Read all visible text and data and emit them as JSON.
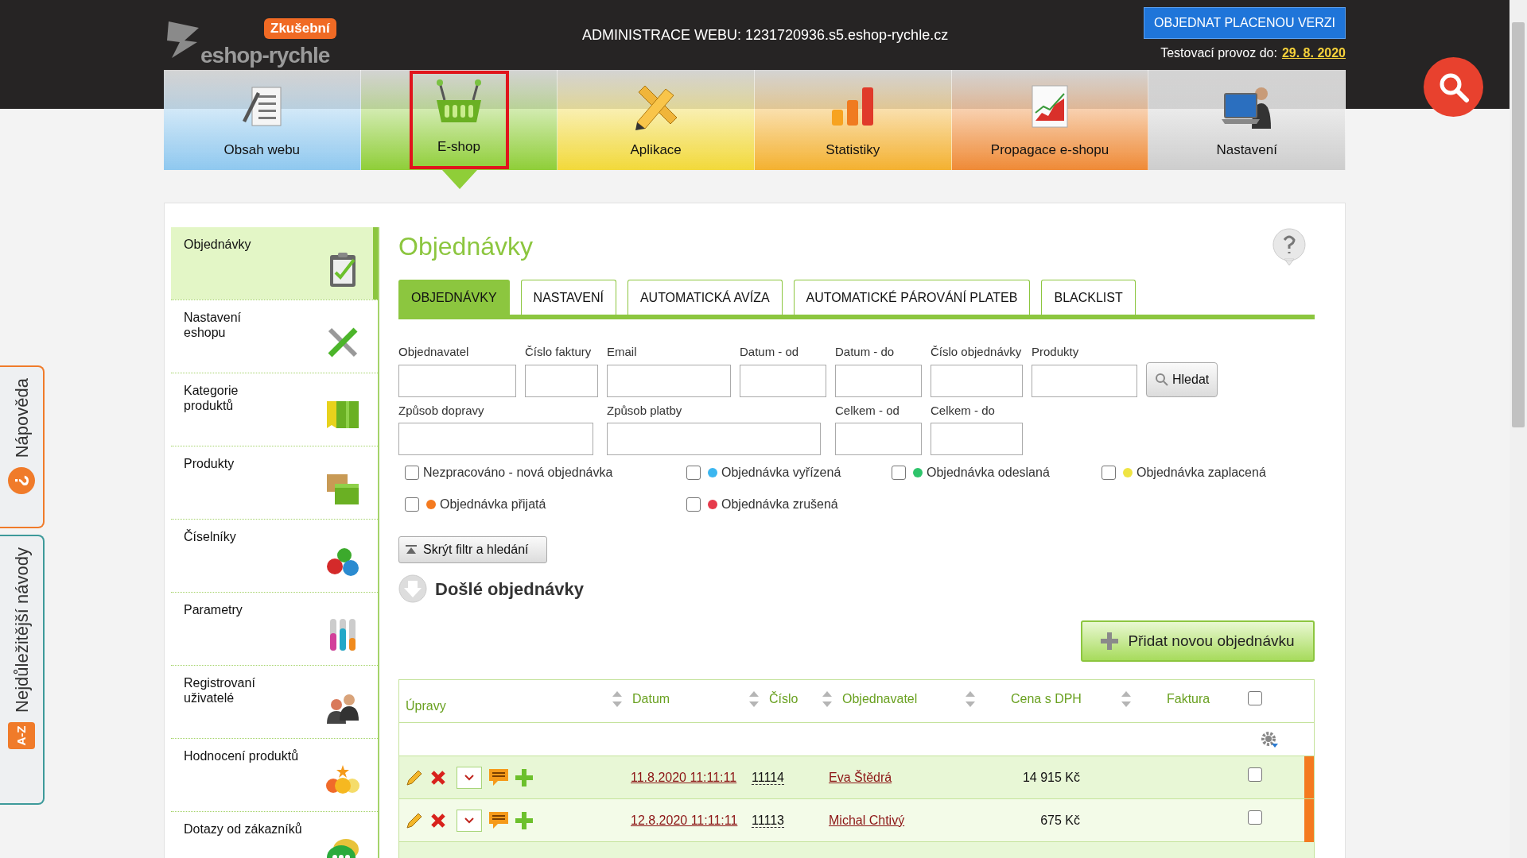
{
  "header": {
    "badge": "Zkušební",
    "logo_text": "eshop-rychle",
    "admin_text": "ADMINISTRACE WEBU: 1231720936.s5.eshop-rychle.cz",
    "order_button": "OBJEDNAT PLACENOU VERZI",
    "trial_label": "Testovací provoz do:",
    "trial_date": "29. 8. 2020"
  },
  "nav": [
    {
      "label": "Obsah webu",
      "kind": "document",
      "color": "#8fc8ef",
      "selected": false,
      "highlighted": false
    },
    {
      "label": "E-shop",
      "kind": "basket",
      "color": "#8fce38",
      "selected": true,
      "highlighted": true
    },
    {
      "label": "Aplikace",
      "kind": "tools",
      "color": "#f2d93a",
      "selected": false,
      "highlighted": false
    },
    {
      "label": "Statistiky",
      "kind": "bars",
      "color": "#f4b130",
      "selected": false,
      "highlighted": false
    },
    {
      "label": "Propagace e-shopu",
      "kind": "chart",
      "color": "#ef8a36",
      "selected": false,
      "highlighted": false
    },
    {
      "label": "Nastavení",
      "kind": "computer",
      "color": "#cdcdcd",
      "selected": false,
      "highlighted": false
    }
  ],
  "side_tabs": [
    {
      "label": "Nápověda",
      "kind": "help",
      "icon_text": "?"
    },
    {
      "label": "Nejdůležitější návody",
      "kind": "az",
      "icon_text": "A-Z"
    }
  ],
  "sidebar": {
    "items": [
      {
        "lines": [
          "Objednávky"
        ],
        "kind": "clipboard",
        "selected": true
      },
      {
        "lines": [
          "Nastavení",
          "eshopu"
        ],
        "kind": "tools",
        "selected": false
      },
      {
        "lines": [
          "Kategorie",
          "produktů"
        ],
        "kind": "folder",
        "selected": false
      },
      {
        "lines": [
          "Produkty"
        ],
        "kind": "boxes",
        "selected": false
      },
      {
        "lines": [
          "Číselníky"
        ],
        "kind": "numbers",
        "selected": false
      },
      {
        "lines": [
          "Parametry"
        ],
        "kind": "sliders",
        "selected": false
      },
      {
        "lines": [
          "Registrovaní",
          "uživatelé"
        ],
        "kind": "users",
        "selected": false
      },
      {
        "lines": [
          "Hodnocení produktů"
        ],
        "kind": "smileys",
        "selected": false
      },
      {
        "lines": [
          "Dotazy od zákazníků"
        ],
        "kind": "chat",
        "selected": false
      }
    ]
  },
  "page_title": "Objednávky",
  "tabs": [
    {
      "label": "OBJEDNÁVKY",
      "selected": true
    },
    {
      "label": "NASTAVENÍ",
      "selected": false
    },
    {
      "label": "AUTOMATICKÁ AVÍZA",
      "selected": false
    },
    {
      "label": "AUTOMATICKÉ PÁROVÁNÍ PLATEB",
      "selected": false
    },
    {
      "label": "BLACKLIST",
      "selected": false
    }
  ],
  "filter": {
    "fields": [
      {
        "label": "Objednavatel"
      },
      {
        "label": "Číslo faktury"
      },
      {
        "label": "Email"
      },
      {
        "label": "Datum - od"
      },
      {
        "label": "Datum - do"
      },
      {
        "label": "Číslo objednávky"
      },
      {
        "label": "Produkty"
      },
      {
        "label": "Způsob dopravy"
      },
      {
        "label": "Způsob platby"
      },
      {
        "label": "Celkem - od"
      },
      {
        "label": "Celkem - do"
      }
    ],
    "search_button": "Hledat",
    "statuses": [
      {
        "label": "Nezpracováno - nová objednávka",
        "checked": false
      },
      {
        "label": "Objednávka vyřízená",
        "color": "#3bb6f0",
        "checked": false
      },
      {
        "label": "Objednávka odeslaná",
        "color": "#2ec46b",
        "checked": false
      },
      {
        "label": "Objednávka zaplacená",
        "color": "#efe443",
        "checked": false
      },
      {
        "label": "Objednávka přijatá",
        "color": "#f47a1f",
        "checked": false
      },
      {
        "label": "Objednávka zrušená",
        "color": "#e63a4b",
        "checked": false
      }
    ],
    "hide_button": "Skrýt filtr a hledání"
  },
  "section_title": "Došlé objednávky",
  "add_button": "Přidat novou objednávku",
  "table": {
    "columns": [
      {
        "label": "Úpravy",
        "sortable": false
      },
      {
        "label": "Datum",
        "sortable": true
      },
      {
        "label": "Číslo",
        "sortable": true
      },
      {
        "label": "Objednavatel",
        "sortable": true
      },
      {
        "label": "Cena s DPH",
        "sortable": true
      },
      {
        "label": "Faktura",
        "sortable": true
      }
    ],
    "select_all_checked": false,
    "rows": [
      {
        "date": "11.8.2020 11:11:11",
        "number": "11114",
        "customer": "Eva Štědrá",
        "price": "14 915 Kč",
        "checked": false,
        "color": "#f47a1f"
      },
      {
        "date": "12.8.2020 11:11:11",
        "number": "11113",
        "customer": "Michal Chtivý",
        "price": "675 Kč",
        "checked": false,
        "color": "#f47a1f"
      }
    ]
  }
}
